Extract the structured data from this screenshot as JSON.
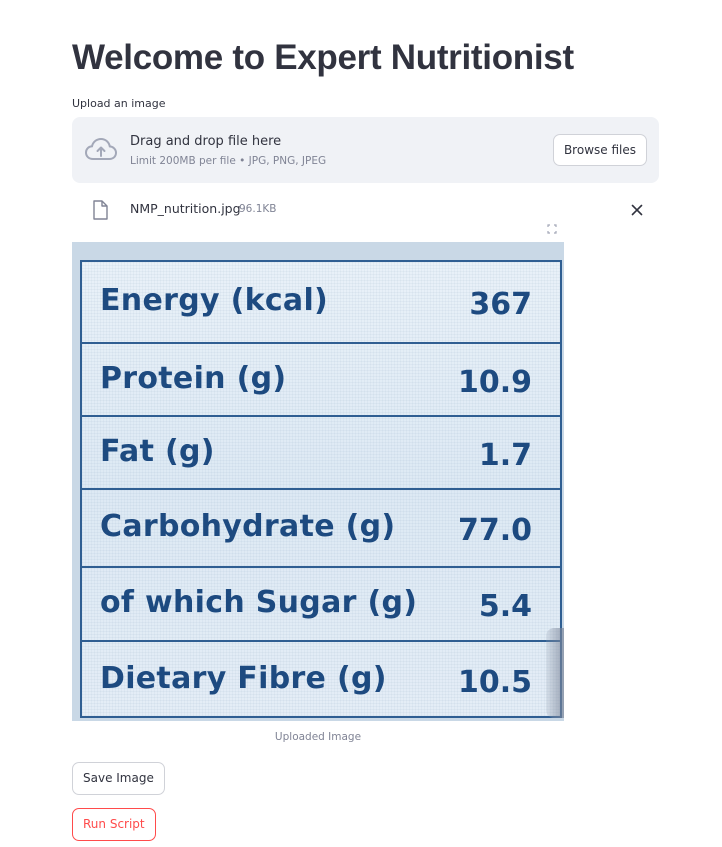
{
  "page": {
    "title": "Welcome to Expert Nutritionist"
  },
  "uploader": {
    "label": "Upload an image",
    "drop_text": "Drag and drop file here",
    "limit_text": "Limit 200MB per file • JPG, PNG, JPEG",
    "browse_label": "Browse files",
    "icon": "cloud-upload-icon"
  },
  "uploaded_file": {
    "name": "NMP_nutrition.jpg",
    "size": "96.1KB",
    "icon": "file-icon",
    "remove_icon": "close-icon"
  },
  "image": {
    "caption": "Uploaded Image",
    "fullscreen_icon": "fullscreen-icon",
    "nutrition_rows": [
      {
        "name": "Energy (kcal)",
        "value": "367"
      },
      {
        "name": "Protein (g)",
        "value": "10.9"
      },
      {
        "name": "Fat (g)",
        "value": "1.7"
      },
      {
        "name": "Carbohydrate (g)",
        "value": "77.0"
      },
      {
        "name": "of which Sugar (g)",
        "value": "5.4"
      },
      {
        "name": "Dietary Fibre (g)",
        "value": "10.5"
      }
    ]
  },
  "actions": {
    "save_label": "Save Image",
    "run_label": "Run Script"
  },
  "colors": {
    "primary": "#ff4b4b",
    "text": "#31333f",
    "muted": "#808495",
    "dropzone_bg": "#f0f2f6",
    "label_blue": "#1d4a80"
  }
}
